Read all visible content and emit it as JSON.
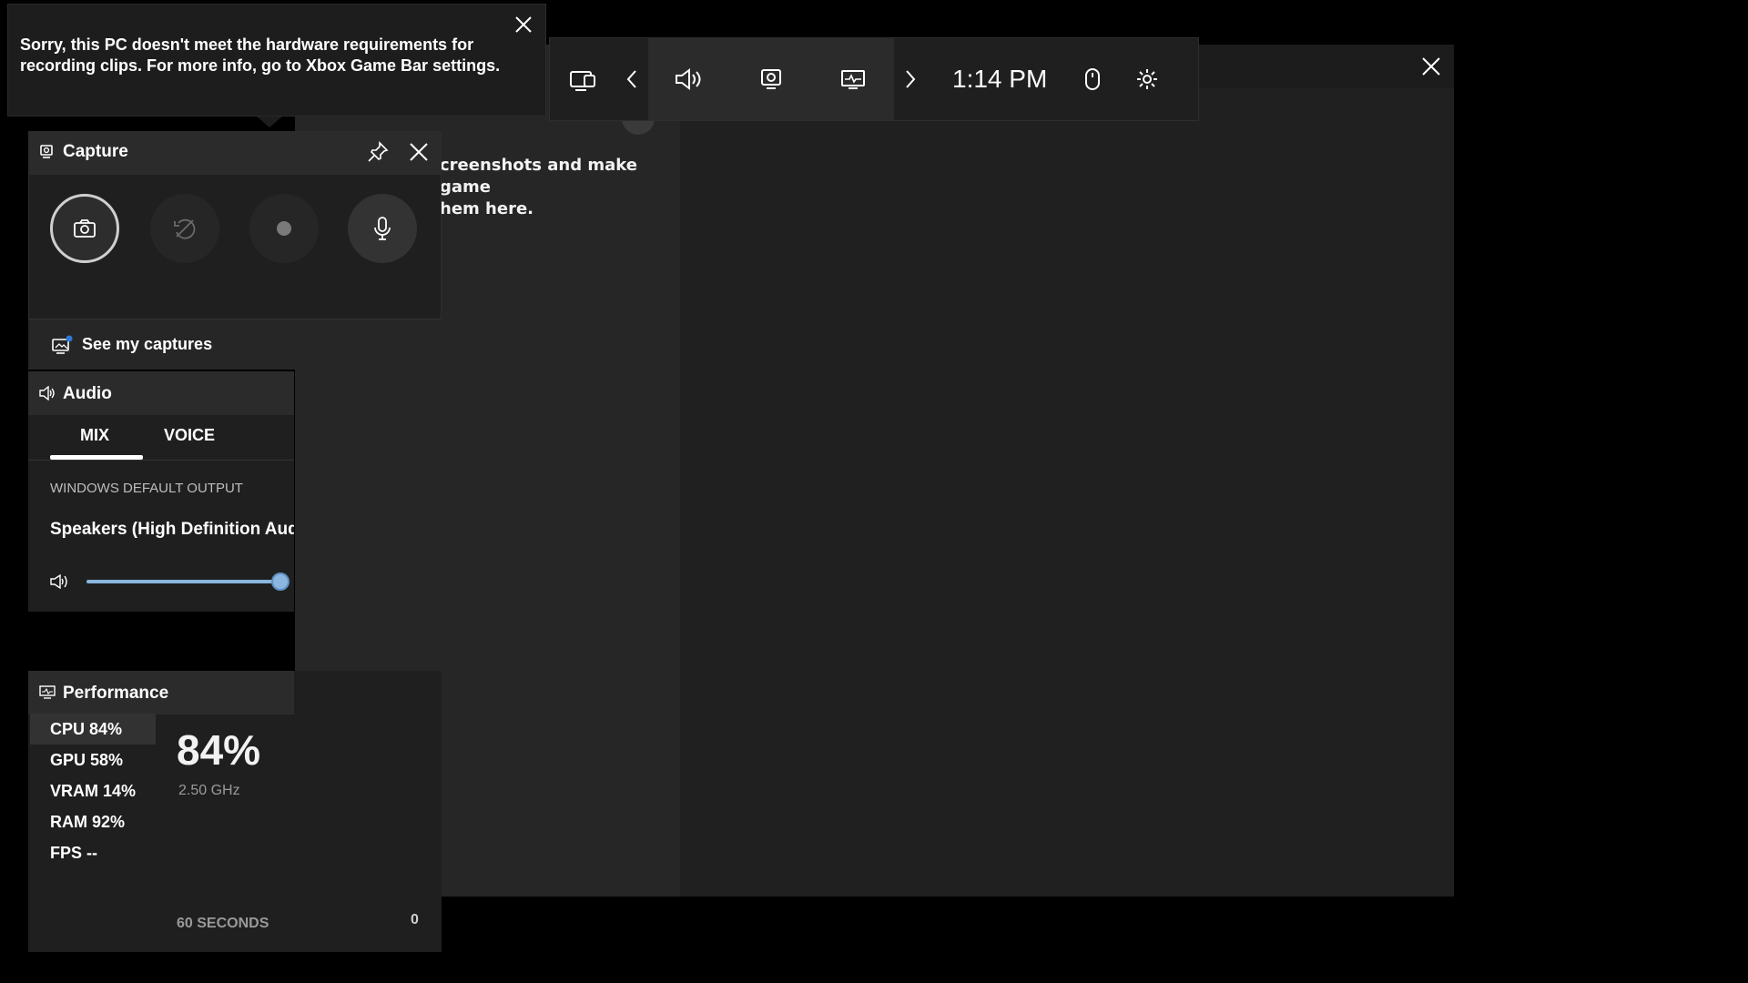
{
  "toast": {
    "message": "Sorry, this PC doesn't meet the hardware requirements for recording clips. For more info, go to Xbox Game Bar settings."
  },
  "topbar": {
    "time": "1:14 PM",
    "icons": [
      "widget-menu-icon",
      "chevron-left-icon",
      "volume-icon",
      "capture-icon",
      "performance-icon",
      "chevron-right-icon",
      "mouse-icon",
      "gear-icon"
    ]
  },
  "gallery": {
    "empty_text": "creenshots and make game\nhem here."
  },
  "capture": {
    "title": "Capture",
    "see_captures": "See my captures"
  },
  "audio": {
    "title": "Audio",
    "tabs": [
      "MIX",
      "VOICE"
    ],
    "active_tab": "MIX",
    "section_label": "WINDOWS DEFAULT OUTPUT",
    "device": "Speakers (High Definition Audi",
    "volume_level": 1.0,
    "accent": "#8ab6e0"
  },
  "performance": {
    "title": "Performance",
    "items": [
      "CPU  84%",
      "GPU  58%",
      "VRAM  14%",
      "RAM  92%",
      "FPS  --"
    ],
    "selected": "CPU",
    "big_value": "84%",
    "frequency": "2.50 GHz",
    "window_label": "60 SECONDS",
    "axis_zero": "0"
  }
}
